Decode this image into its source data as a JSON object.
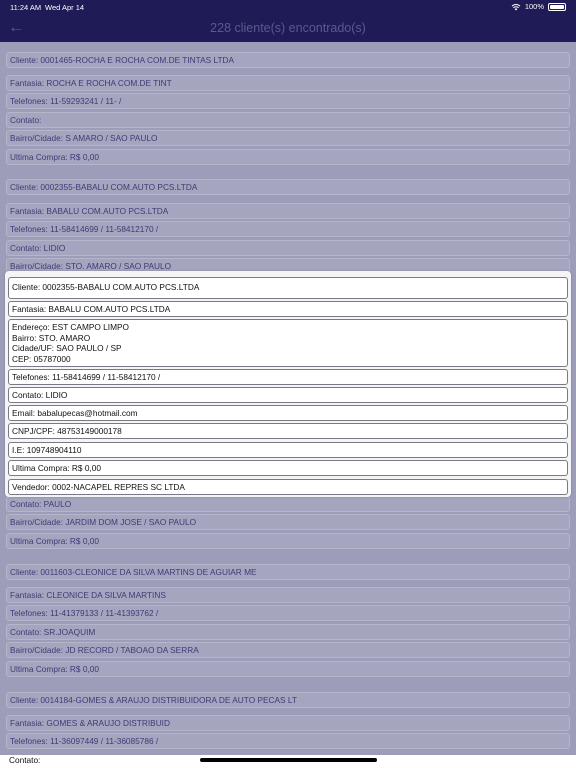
{
  "status": {
    "time": "11:24 AM",
    "date": "Wed Apr 14",
    "battery": "100%"
  },
  "nav": {
    "title": "228 cliente(s) encontrado(s)",
    "back_icon": "arrow-left-icon"
  },
  "list": [
    "Cliente: 0001465-ROCHA E ROCHA COM.DE TINTAS LTDA",
    "Fantasia: ROCHA E ROCHA COM.DE TINT",
    "Telefones: 11-59293241 / 11- /",
    "Contato:",
    "Bairro/Cidade: S AMARO / SAO PAULO",
    "Ultima Compra:   R$ 0,00",
    "Cliente: 0002355-BABALU COM.AUTO PCS.LTDA",
    "Fantasia: BABALU COM.AUTO PCS.LTDA",
    "Telefones: 11-58414699 / 11-58412170 /",
    "Contato: LIDIO",
    "Bairro/Cidade: STO. AMARO / SAO PAULO",
    "Contato: PAULO",
    "Bairro/Cidade: JARDIM DOM JOSE / SAO PAULO",
    "Ultima Compra:   R$ 0,00",
    "Cliente: 0011603-CLEONICE DA SILVA MARTINS DE AGUIAR ME",
    "Fantasia: CLEONICE DA SILVA MARTINS",
    "Telefones: 11-41379133 / 11-41393762 /",
    "Contato: SR.JOAQUIM",
    "Bairro/Cidade: JD RECORD / TABOAO DA SERRA",
    "Ultima Compra:   R$ 0,00",
    "Cliente: 0014184-GOMES & ARAUJO DISTRIBUIDORA DE AUTO PECAS LT",
    "Fantasia: GOMES & ARAUJO DISTRIBUID",
    "Telefones: 11-36097449 / 11-36085786 /",
    "Contato:"
  ],
  "detail": {
    "cliente": "Cliente: 0002355-BABALU COM.AUTO PCS.LTDA",
    "fantasia": "Fantasia: BABALU COM.AUTO PCS.LTDA",
    "endereco": "Endereço: EST CAMPO LIMPO",
    "bairro": "Bairro: STO. AMARO",
    "cidade": "Cidade/UF: SAO PAULO / SP",
    "cep": "CEP: 05787000",
    "telefones": "Telefones: 11-58414699 / 11-58412170 /",
    "contato": "Contato: LIDIO",
    "email": "Email: babalupecas@hotmail.com",
    "cnpj": "CNPJ/CPF: 48753149000178",
    "ie": "I.E: 109748904110",
    "ultima": "Ultima Compra:   R$ 0,00",
    "vendedor": "Vendedor: 0002-NACAPEL REPRES SC LTDA"
  }
}
